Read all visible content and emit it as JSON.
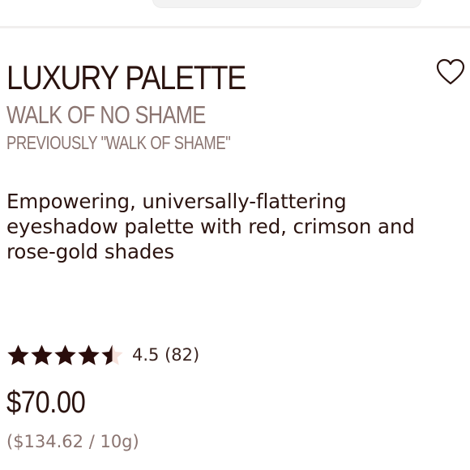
{
  "product": {
    "title": "LUXURY PALETTE",
    "shade_name": "WALK OF NO SHAME",
    "previous_name": "PREVIOUSLY \"WALK OF SHAME\"",
    "description": "Empowering, universally-flattering eyeshadow palette with red, crimson and rose-gold shades",
    "rating": {
      "value": 4.5,
      "max": 5,
      "label": "4.5 (82)"
    },
    "price": "$70.00",
    "unit_price": "($134.62 / 10g)"
  },
  "icons": {
    "wishlist": "heart-outline-icon",
    "star": "star-icon"
  },
  "colors": {
    "text_dark": "#2a130f",
    "text_muted": "#8a7470",
    "star_filled": "#2a0d0b",
    "star_empty": "#f7e3dd"
  }
}
